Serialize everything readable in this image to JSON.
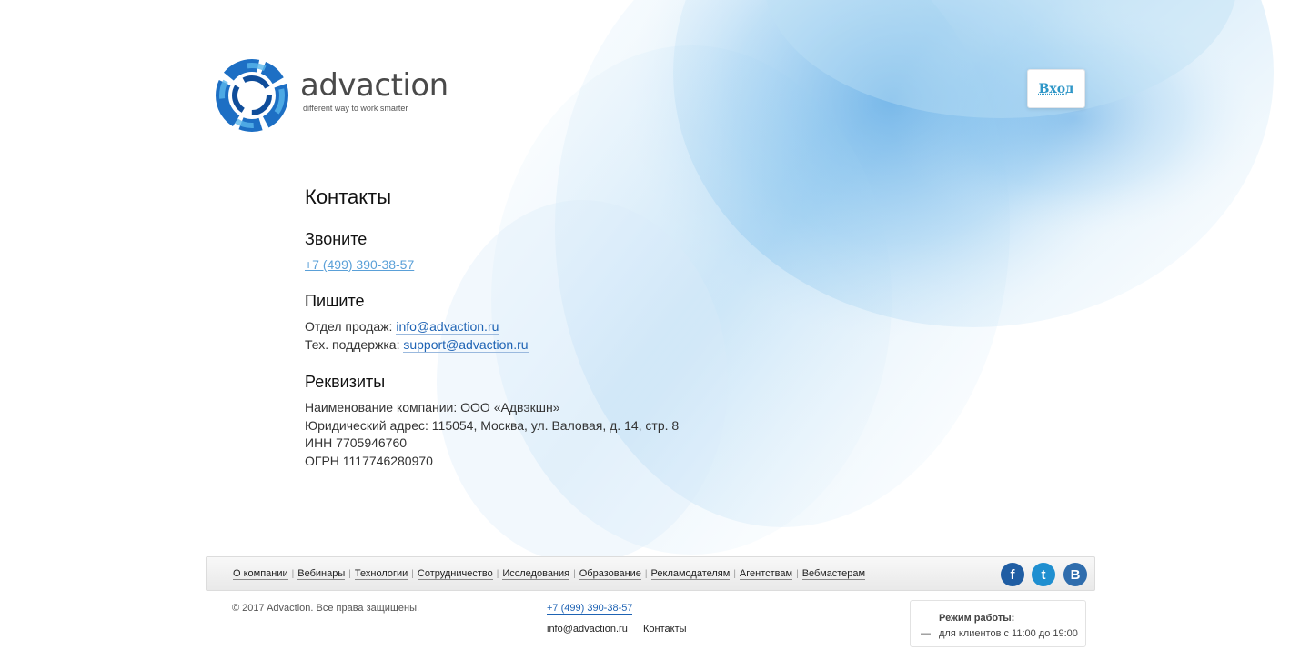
{
  "header": {
    "logo_name": "advaction",
    "logo_tagline": "different way to work smarter",
    "login_label": "Вход"
  },
  "contacts": {
    "title": "Контакты",
    "call": {
      "heading": "Звоните",
      "phone": "+7 (499) 390-38-57"
    },
    "write": {
      "heading": "Пишите",
      "sales_label": "Отдел продаж:",
      "sales_email": "info@advaction.ru",
      "support_label": "Тех. поддержка:",
      "support_email": "support@advaction.ru"
    },
    "requisites": {
      "heading": "Реквизиты",
      "lines": [
        "Наименование компании: ООО «Адвэкшн»",
        "Юридический адрес: 115054, Москва, ул. Валовая, д. 14, стр. 8",
        "ИНН 7705946760",
        "ОГРН 1117746280970"
      ]
    }
  },
  "footer": {
    "nav": [
      "О компании",
      "Вебинары",
      "Технологии",
      "Сотрудничество",
      "Исследования",
      "Образование",
      "Рекламодателям",
      "Агентствам",
      "Вебмастерам"
    ],
    "social": [
      {
        "name": "facebook-icon",
        "glyph": "f",
        "color": "#1f5da3"
      },
      {
        "name": "twitter-icon",
        "glyph": "t",
        "color": "#1f8fd0"
      },
      {
        "name": "vk-icon",
        "glyph": "B",
        "color": "#2f6dad"
      }
    ],
    "copyright": "© 2017 Advaction. Все права защищены.",
    "phone": "+7 (499) 390-38-57",
    "email": "info@advaction.ru",
    "contacts_link": "Контакты",
    "hours_title": "Режим работы:",
    "hours_dash": "—",
    "hours_text": "для клиентов с 11:00 до 19:00"
  }
}
